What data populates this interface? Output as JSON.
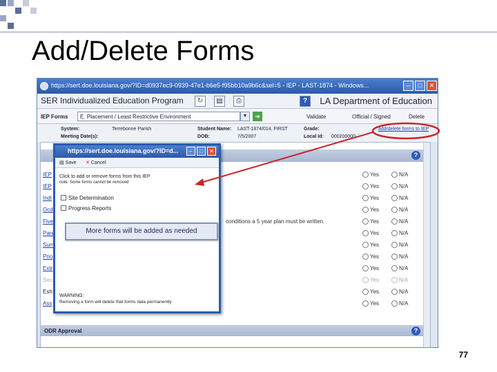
{
  "slide": {
    "title": "Add/Delete Forms",
    "page_number": "77",
    "accent_color": "#5b6e96"
  },
  "window": {
    "title": "https://sert.doe.louisiana.gov/?ID=d0937ec9-0939-47e1-b6e5-f95bb10a9b6c&sel=5 - IEP - LAST-1874 - Windows...",
    "minimize_icon": "minimize-icon",
    "maximize_icon": "maximize-icon",
    "close_icon": "close-icon"
  },
  "app": {
    "program_name": "SER Individualized Education Program",
    "department": "LA Department of Education"
  },
  "forms_bar": {
    "label": "IEP Forms",
    "selected_form": "E. Placement / Least Restrictive Environment",
    "validate": "Validate",
    "official_signed": "Official / Signed",
    "delete": "Delete"
  },
  "info": {
    "system_label": "System:",
    "system_value": "Terrebonne Parish",
    "meeting_label": "Meeting Date(s):",
    "student_label": "Student Name:",
    "student_value": "LAST-1874/014, FIRST",
    "dob_label": "DOB:",
    "dob_value": "7/5/2007",
    "grade_label": "Grade:",
    "local_id_label": "Local Id:",
    "local_id_value": "000200000",
    "add_delete_link": "add/delete forms to IEP"
  },
  "rows": [
    {
      "label": "IEP",
      "yes": "Yes",
      "na": "N/A"
    },
    {
      "label": "IEP",
      "yes": "Yes",
      "na": "N/A"
    },
    {
      "label": "Indi",
      "yes": "Yes",
      "na": "N/A"
    },
    {
      "label": "Ocd",
      "yes": "Yes",
      "na": "N/A"
    },
    {
      "label": "Five",
      "yes": "Yes",
      "na": "N/A"
    },
    {
      "label": "Pare",
      "yes": "Yes",
      "na": "N/A"
    },
    {
      "label": "Sum",
      "yes": "Yes",
      "na": "N/A"
    },
    {
      "label": "Prio",
      "yes": "Yes",
      "na": "N/A"
    },
    {
      "label": "Extr",
      "yes": "Yes",
      "na": "N/A"
    },
    {
      "label": "Sec",
      "yes": "Yes",
      "na": "N/A"
    },
    {
      "label": "Esh",
      "yes": "Yes",
      "na": "N/A"
    },
    {
      "label": "Ass",
      "yes": "Yes",
      "na": "N/A"
    }
  ],
  "notice_text": "conditions a 5 year plan must be written.",
  "odr_label": "ODR Approval",
  "popup": {
    "title": "https://sert.doe.louisiana.gov/?ID=d...",
    "save": "Save",
    "cancel": "Cancel",
    "instruction": "Click to add or remove forms from this IEP",
    "note": "note: Some forms cannot be removed",
    "option_1": "Site Determination",
    "option_2": "Progress Reports",
    "callout": "More forms will be added as needed",
    "warning_title": "WARNING:",
    "warning_text": "Removing a form will delete that forms data permanently"
  },
  "annotation_color": "#c9252b"
}
